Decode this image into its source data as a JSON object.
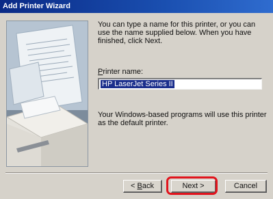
{
  "window": {
    "title": "Add Printer Wizard"
  },
  "intro": "You can type a name for this printer, or you can use the name supplied below. When you have finished, click Next.",
  "printer_name": {
    "label_prefix": "",
    "label_mnemonic": "P",
    "label_rest": "rinter name:",
    "value": "HP LaserJet Series II"
  },
  "default_note": "Your Windows-based programs will use this printer as the default printer.",
  "buttons": {
    "back_prefix": "< ",
    "back_mnemonic": "B",
    "back_rest": "ack",
    "next": "Next >",
    "cancel": "Cancel"
  },
  "colors": {
    "titlebar": "#0a2a86",
    "selection": "#1b2f8c",
    "highlight": "#e1141d"
  }
}
